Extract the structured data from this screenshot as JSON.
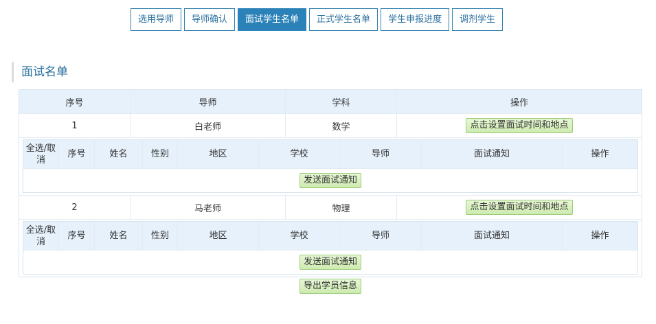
{
  "tabs": [
    {
      "label": "选用导师",
      "active": false
    },
    {
      "label": "导师确认",
      "active": false
    },
    {
      "label": "面试学生名单",
      "active": true
    },
    {
      "label": "正式学生名单",
      "active": false
    },
    {
      "label": "学生申报进度",
      "active": false
    },
    {
      "label": "调剂学生",
      "active": false
    }
  ],
  "section_title": "面试名单",
  "main_table": {
    "headers": [
      "序号",
      "导师",
      "学科",
      "操作"
    ],
    "rows": [
      {
        "index": "1",
        "teacher": "白老师",
        "subject": "数学",
        "action_label": "点击设置面试时间和地点",
        "nested": {
          "headers": [
            "全选/取消",
            "序号",
            "姓名",
            "性别",
            "地区",
            "学校",
            "导师",
            "面试通知",
            "操作"
          ],
          "send_label": "发送面试通知"
        }
      },
      {
        "index": "2",
        "teacher": "马老师",
        "subject": "物理",
        "action_label": "点击设置面试时间和地点",
        "nested": {
          "headers": [
            "全选/取消",
            "序号",
            "姓名",
            "性别",
            "地区",
            "学校",
            "导师",
            "面试通知",
            "操作"
          ],
          "send_label": "发送面试通知"
        }
      }
    ]
  },
  "export_label": "导出学员信息",
  "colors": {
    "accent": "#2b82b8",
    "header_bg": "#e6f1fb",
    "green_button": "#cdebb0"
  }
}
